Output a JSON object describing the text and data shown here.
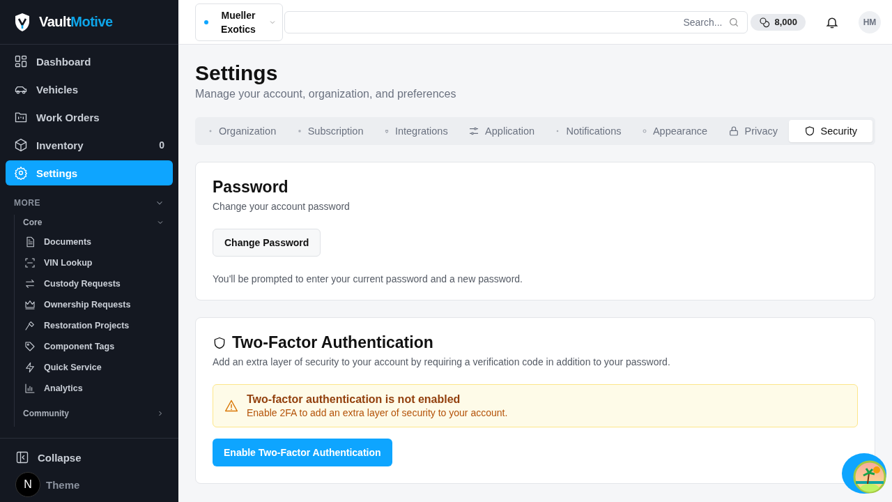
{
  "brand": {
    "primary": "Vault",
    "accent": "Motive"
  },
  "nav": [
    {
      "label": "Dashboard",
      "selected": false
    },
    {
      "label": "Vehicles",
      "selected": false
    },
    {
      "label": "Work Orders",
      "selected": false
    },
    {
      "label": "Inventory",
      "selected": false,
      "count": "0"
    },
    {
      "label": "Settings",
      "selected": true
    }
  ],
  "more": {
    "label": "MORE",
    "expanded": true,
    "groups": [
      {
        "label": "Core",
        "expanded": true,
        "items": [
          {
            "label": "Documents"
          },
          {
            "label": "VIN Lookup"
          },
          {
            "label": "Custody Requests"
          },
          {
            "label": "Ownership Requests"
          },
          {
            "label": "Restoration Projects"
          },
          {
            "label": "Component Tags"
          },
          {
            "label": "Quick Service"
          },
          {
            "label": "Analytics"
          }
        ]
      },
      {
        "label": "Community",
        "expanded": false
      }
    ]
  },
  "footer": {
    "collapse": "Collapse",
    "theme": "Theme",
    "badge": "N"
  },
  "header": {
    "organization": "Mueller Exotics",
    "search_placeholder": "Search...",
    "credits": "8,000",
    "avatar": "HM"
  },
  "page": {
    "title": "Settings",
    "subtitle": "Manage your account, organization, and preferences"
  },
  "tabs": [
    {
      "label": "Organization",
      "selected": false
    },
    {
      "label": "Subscription",
      "selected": false
    },
    {
      "label": "Integrations",
      "selected": false
    },
    {
      "label": "Application",
      "selected": false
    },
    {
      "label": "Notifications",
      "selected": false
    },
    {
      "label": "Appearance",
      "selected": false
    },
    {
      "label": "Privacy",
      "selected": false
    },
    {
      "label": "Security",
      "selected": true
    }
  ],
  "password": {
    "title": "Password",
    "description": "Change your account password",
    "button": "Change Password",
    "note": "You'll be prompted to enter your current password and a new password."
  },
  "two_factor": {
    "title": "Two-Factor Authentication",
    "description": "Add an extra layer of security to your account by requiring a verification code in addition to your password.",
    "alert": {
      "title": "Two-factor authentication is not enabled",
      "message": "Enable 2FA to add an extra layer of security to your account."
    },
    "button": "Enable Two-Factor Authentication"
  }
}
